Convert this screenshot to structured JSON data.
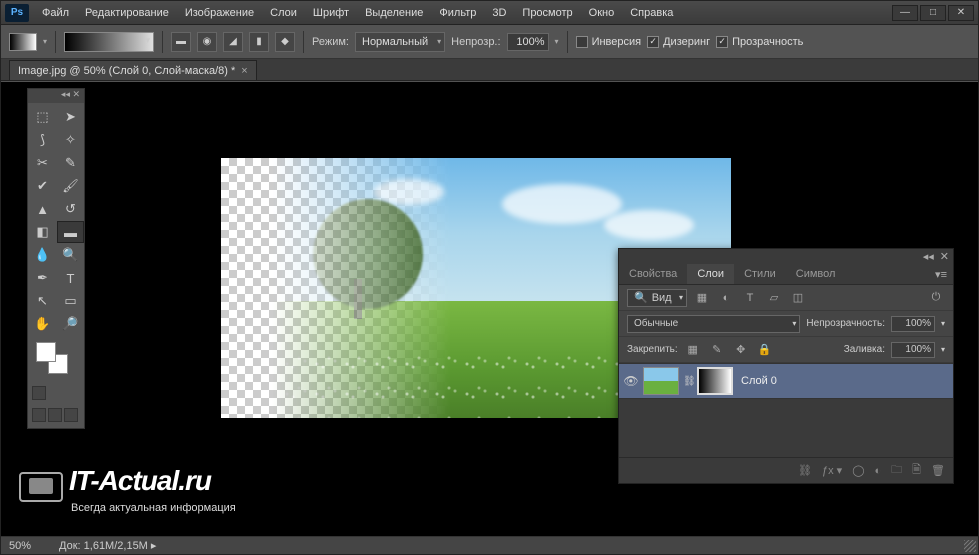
{
  "app": {
    "logo": "Ps"
  },
  "menu": [
    "Файл",
    "Редактирование",
    "Изображение",
    "Слои",
    "Шрифт",
    "Выделение",
    "Фильтр",
    "3D",
    "Просмотр",
    "Окно",
    "Справка"
  ],
  "optbar": {
    "mode_label": "Режим:",
    "mode_value": "Нормальный",
    "opacity_label": "Непрозр.:",
    "opacity_value": "100%",
    "inv_label": "Инверсия",
    "dither_label": "Дизеринг",
    "transp_label": "Прозрачность"
  },
  "doc": {
    "tab_label": "Image.jpg @ 50% (Слой 0, Слой-маска/8) *"
  },
  "panel": {
    "tabs": [
      "Свойства",
      "Слои",
      "Стили",
      "Символ"
    ],
    "active_tab": 1,
    "filter_label": "Вид",
    "blend_label": "Обычные",
    "opacity_label": "Непрозрачность:",
    "opacity_value": "100%",
    "lock_label": "Закрепить:",
    "fill_label": "Заливка:",
    "fill_value": "100%",
    "layer0_name": "Слой 0"
  },
  "status": {
    "zoom": "50%",
    "doc": "Док: 1,61M/2,15M"
  },
  "watermark": {
    "title": "IT-Actual.ru",
    "sub": "Всегда актуальная информация"
  }
}
